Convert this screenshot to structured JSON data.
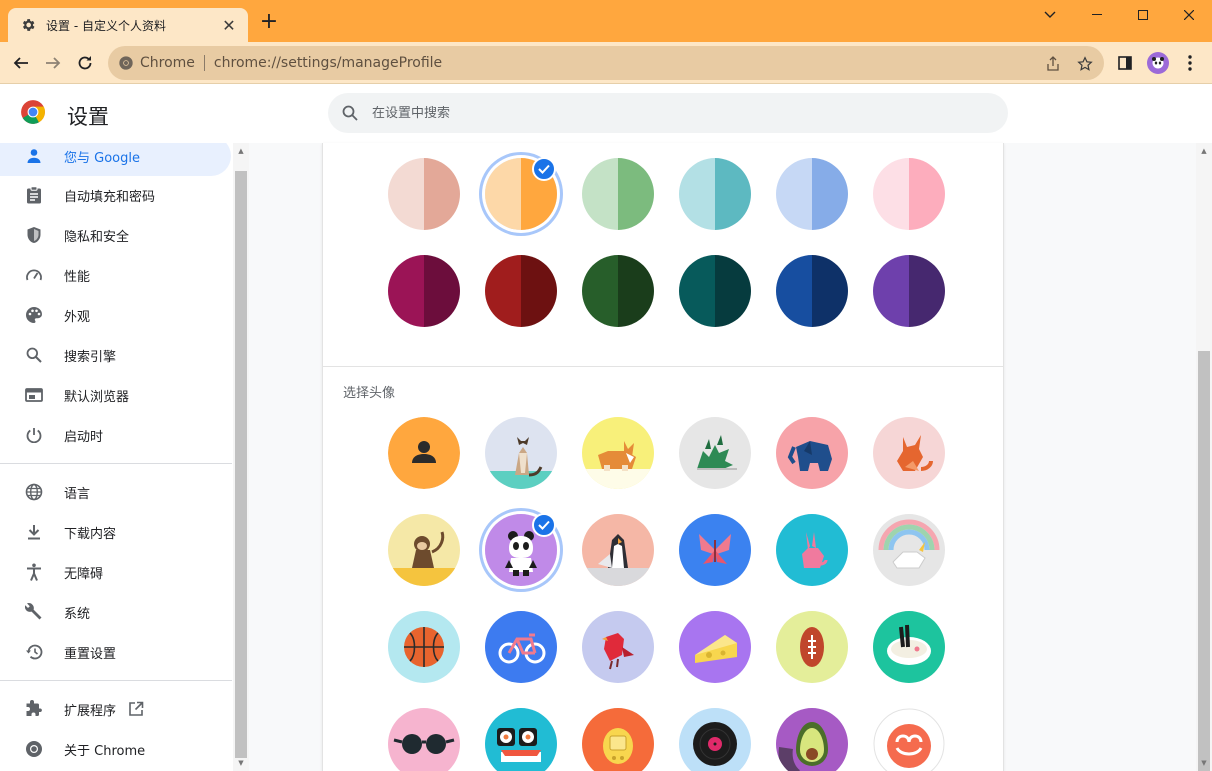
{
  "browser": {
    "tab_title": "设置 - 自定义个人资料",
    "omnibox_site": "Chrome",
    "omnibox_url": "chrome://settings/manageProfile",
    "frame_color": "#FFA73E",
    "toolbar_color": "#FDE7C7"
  },
  "header": {
    "title": "设置",
    "search_placeholder": "在设置中搜索"
  },
  "sidebar": {
    "items": [
      {
        "label": "您与 Google",
        "icon": "person-icon",
        "selected": true
      },
      {
        "label": "自动填充和密码",
        "icon": "clipboard-icon"
      },
      {
        "label": "隐私和安全",
        "icon": "shield-icon"
      },
      {
        "label": "性能",
        "icon": "speedometer-icon"
      },
      {
        "label": "外观",
        "icon": "palette-icon"
      },
      {
        "label": "搜索引擎",
        "icon": "search-icon"
      },
      {
        "label": "默认浏览器",
        "icon": "browser-window-icon"
      },
      {
        "label": "启动时",
        "icon": "power-icon"
      },
      {
        "label": "语言",
        "icon": "globe-icon"
      },
      {
        "label": "下载内容",
        "icon": "download-icon"
      },
      {
        "label": "无障碍",
        "icon": "accessibility-icon"
      },
      {
        "label": "系统",
        "icon": "wrench-icon"
      },
      {
        "label": "重置设置",
        "icon": "history-icon"
      },
      {
        "label": "扩展程序",
        "icon": "puzzle-icon"
      },
      {
        "label": "关于 Chrome",
        "icon": "chrome-icon"
      }
    ]
  },
  "main": {
    "avatar_section_label": "选择头像",
    "color_themes": [
      {
        "name": "rose",
        "left": "#F3DAD3",
        "right": "#E3A898"
      },
      {
        "name": "orange",
        "left": "#FDD8A8",
        "right": "#FFA73E",
        "selected": true
      },
      {
        "name": "green",
        "left": "#C4E2C6",
        "right": "#7CBB7E"
      },
      {
        "name": "teal",
        "left": "#B3E0E5",
        "right": "#5DB9C1"
      },
      {
        "name": "blue",
        "left": "#C6D8F5",
        "right": "#86ACE8"
      },
      {
        "name": "pink",
        "left": "#FDDFE6",
        "right": "#FDADBD"
      },
      {
        "name": "magenta",
        "left": "#9B1456",
        "right": "#6C0D3C"
      },
      {
        "name": "red",
        "left": "#A01D1D",
        "right": "#6D1111"
      },
      {
        "name": "forest",
        "left": "#275E2A",
        "right": "#1A3D1B"
      },
      {
        "name": "dark-teal",
        "left": "#075A5B",
        "right": "#063B3E"
      },
      {
        "name": "navy",
        "left": "#174EA0",
        "right": "#0E3168"
      },
      {
        "name": "purple",
        "left": "#6E40AC",
        "right": "#46286F"
      }
    ],
    "avatars": [
      {
        "name": "generic-person",
        "bg": "#FFA73E"
      },
      {
        "name": "cat",
        "bg": "#DDE3F0"
      },
      {
        "name": "corgi",
        "bg": "#F8F07A"
      },
      {
        "name": "dragon",
        "bg": "#E6E6E6"
      },
      {
        "name": "elephant",
        "bg": "#F7A3A9"
      },
      {
        "name": "fox",
        "bg": "#F6D6D6"
      },
      {
        "name": "monkey",
        "bg": "#F5E8A7"
      },
      {
        "name": "panda",
        "bg": "#C08AE8",
        "selected": true
      },
      {
        "name": "penguin",
        "bg": "#F5B7A6"
      },
      {
        "name": "butterfly",
        "bg": "#3B82F0"
      },
      {
        "name": "rabbit",
        "bg": "#21BCD4"
      },
      {
        "name": "unicorn",
        "bg": "#E6E6E6"
      },
      {
        "name": "basketball",
        "bg": "#B4E8F0"
      },
      {
        "name": "bike",
        "bg": "#3D7BF0"
      },
      {
        "name": "bird",
        "bg": "#C5CAEF"
      },
      {
        "name": "cheese",
        "bg": "#A875F0"
      },
      {
        "name": "football",
        "bg": "#E4EE9A"
      },
      {
        "name": "ramen",
        "bg": "#1DC49E"
      },
      {
        "name": "sunglasses",
        "bg": "#F6B4CF"
      },
      {
        "name": "sushi",
        "bg": "#21BCD4"
      },
      {
        "name": "tamagotchi",
        "bg": "#F56B3A"
      },
      {
        "name": "vinyl",
        "bg": "#BDE0F8"
      },
      {
        "name": "avocado",
        "bg": "#A65AC4"
      },
      {
        "name": "smiley",
        "bg": "#FFFFFF"
      }
    ]
  }
}
